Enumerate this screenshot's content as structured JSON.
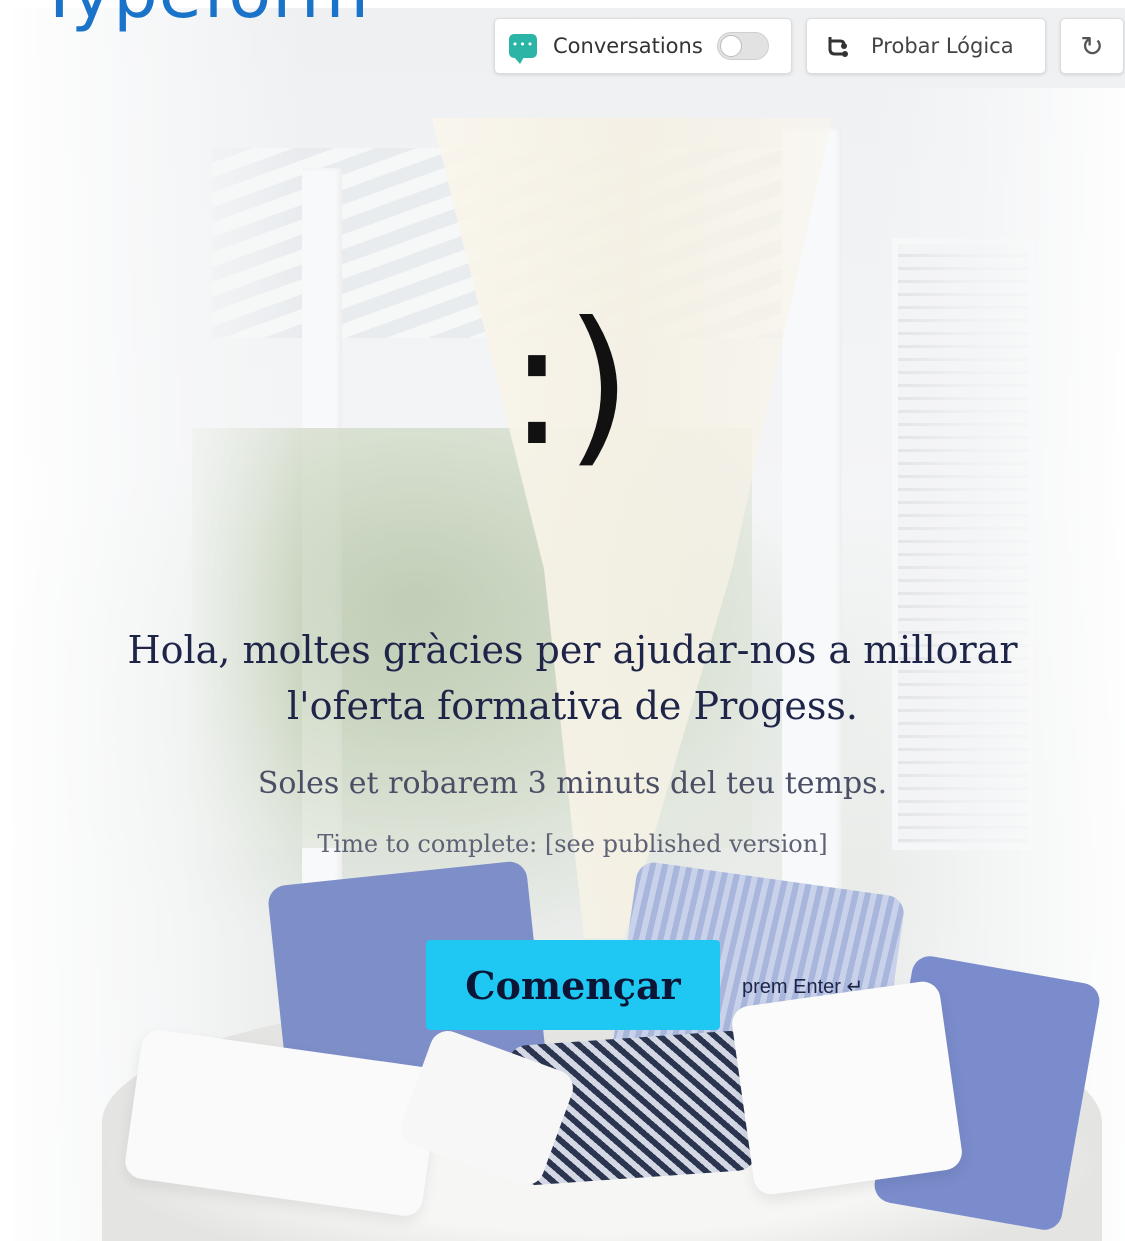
{
  "brand": {
    "logo_text": "Typeform"
  },
  "toolbar": {
    "conversations_label": "Conversations",
    "conversations_enabled": false,
    "test_logic_label": "Probar Lógica",
    "reload_glyph": "↻"
  },
  "welcome": {
    "emoticon": ":)",
    "title_line1": "Hola, moltes gràcies per ajudar-nos a millorar",
    "title_line2": "l'oferta formativa de Progess.",
    "subtitle": "Soles et robarem 3 minuts del teu temps.",
    "time_to_complete": "Time to complete: [see published version]",
    "start_button": "Començar",
    "keyboard_hint": "prem Enter ↵"
  },
  "colors": {
    "accent_button": "#1fc8f3",
    "title_text": "#1e2548",
    "brand_blue": "#1a73c9",
    "conversations_icon": "#2bb5a6"
  },
  "icons": [
    "chat-bubble-icon",
    "toggle-switch",
    "logic-branch-icon",
    "reload-icon"
  ]
}
